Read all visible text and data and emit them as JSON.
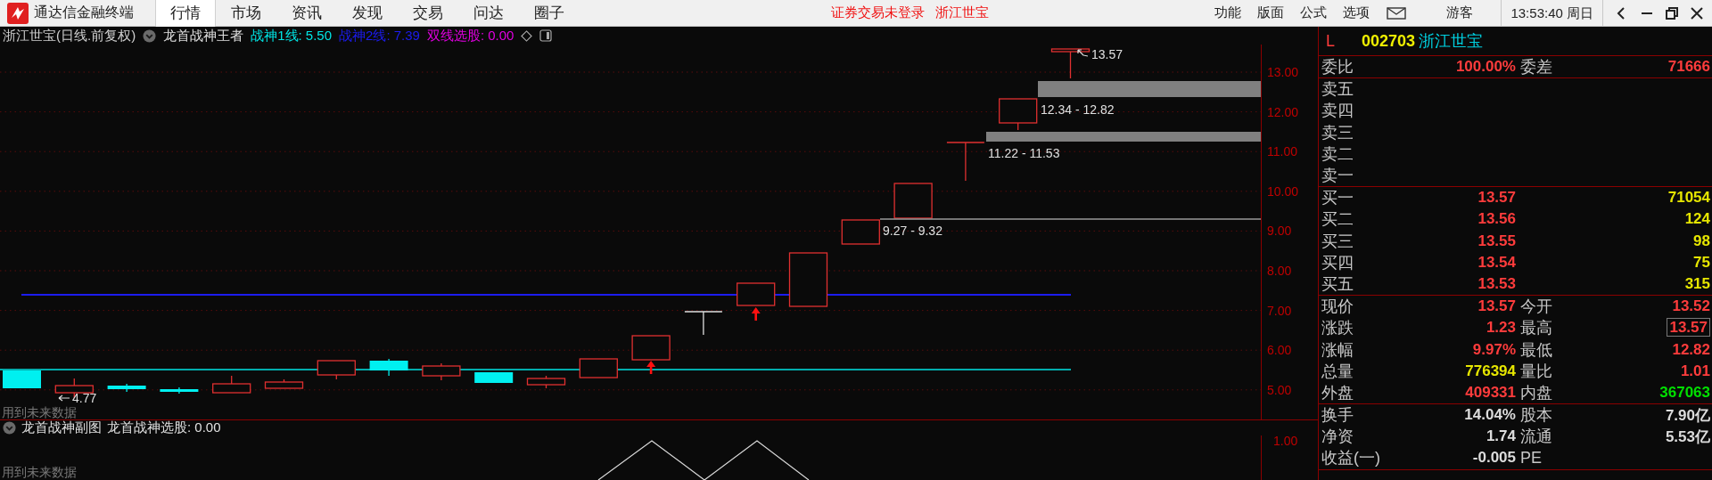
{
  "app": {
    "title": "通达信金融终端"
  },
  "tabs": [
    {
      "label": "行情",
      "selected": true
    },
    {
      "label": "市场",
      "selected": false
    },
    {
      "label": "资讯",
      "selected": false
    },
    {
      "label": "发现",
      "selected": false
    },
    {
      "label": "交易",
      "selected": false
    },
    {
      "label": "问达",
      "selected": false
    },
    {
      "label": "圈子",
      "selected": false
    }
  ],
  "notice": {
    "login_status": "证券交易未登录",
    "stock": "浙江世宝"
  },
  "menu": [
    "功能",
    "版面",
    "公式",
    "选项"
  ],
  "user": "游客",
  "clock": "13:53:40 周日",
  "chart": {
    "title": "浙江世宝(日线.前复权)",
    "indicator": "龙首战神王者",
    "legend": [
      {
        "label": "战神1线: 5.50",
        "color": "#00e5e5"
      },
      {
        "label": "战神2线: 7.39",
        "color": "#1c1cf0"
      },
      {
        "label": "双线选股: 0.00",
        "color": "#e000e0"
      }
    ],
    "price_ticks": [
      "13.00",
      "12.00",
      "11.00",
      "10.00",
      "9.00",
      "8.00",
      "7.00",
      "6.00",
      "5.00"
    ],
    "zones": [
      "12.34 - 12.82",
      "11.22 - 11.53",
      "9.27 - 9.32"
    ],
    "high_marker": "13.57",
    "low_marker": "4.77",
    "warning": "用到未来数据"
  },
  "sub_chart": {
    "title": "龙首战神副图",
    "legend": "龙首战神选股: 0.00",
    "tick": "1.00",
    "warning": "用到未来数据"
  },
  "quote": {
    "market_flag": "L",
    "code": "002703",
    "name": "浙江世宝",
    "ratio": {
      "label": "委比",
      "value": "100.00%",
      "label2": "委差",
      "value2": "71666"
    },
    "asks": [
      "卖五",
      "卖四",
      "卖三",
      "卖二",
      "卖一"
    ],
    "bids": [
      {
        "label": "买一",
        "price": "13.57",
        "volume": "71054"
      },
      {
        "label": "买二",
        "price": "13.56",
        "volume": "124"
      },
      {
        "label": "买三",
        "price": "13.55",
        "volume": "98"
      },
      {
        "label": "买四",
        "price": "13.54",
        "volume": "75"
      },
      {
        "label": "买五",
        "price": "13.53",
        "volume": "315"
      }
    ],
    "stats": [
      {
        "left": {
          "label": "现价",
          "value": "13.57",
          "color": "#ff3c3c"
        },
        "right": {
          "label": "今开",
          "value": "13.52",
          "color": "#ff3c3c",
          "outlined": false
        }
      },
      {
        "left": {
          "label": "涨跌",
          "value": "1.23",
          "color": "#ff3c3c"
        },
        "right": {
          "label": "最高",
          "value": "13.57",
          "color": "#ff3c3c",
          "outlined": true
        }
      },
      {
        "left": {
          "label": "涨幅",
          "value": "9.97%",
          "color": "#ff3c3c"
        },
        "right": {
          "label": "最低",
          "value": "12.82",
          "color": "#ff3c3c",
          "outlined": false
        }
      },
      {
        "left": {
          "label": "总量",
          "value": "776394",
          "color": "#e6e600"
        },
        "right": {
          "label": "量比",
          "value": "1.01",
          "color": "#ff3c3c",
          "outlined": false
        }
      },
      {
        "left": {
          "label": "外盘",
          "value": "409331",
          "color": "#ff3c3c"
        },
        "right": {
          "label": "内盘",
          "value": "367063",
          "color": "#00e000",
          "outlined": false
        }
      }
    ],
    "extras": [
      {
        "label": "换手",
        "value": "14.04%",
        "label2": "股本",
        "value2": "7.90亿"
      },
      {
        "label": "净资",
        "value": "1.74",
        "label2": "流通",
        "value2": "5.53亿"
      },
      {
        "label": "收益(一)",
        "value": "-0.005",
        "label2": "PE"
      }
    ]
  }
}
